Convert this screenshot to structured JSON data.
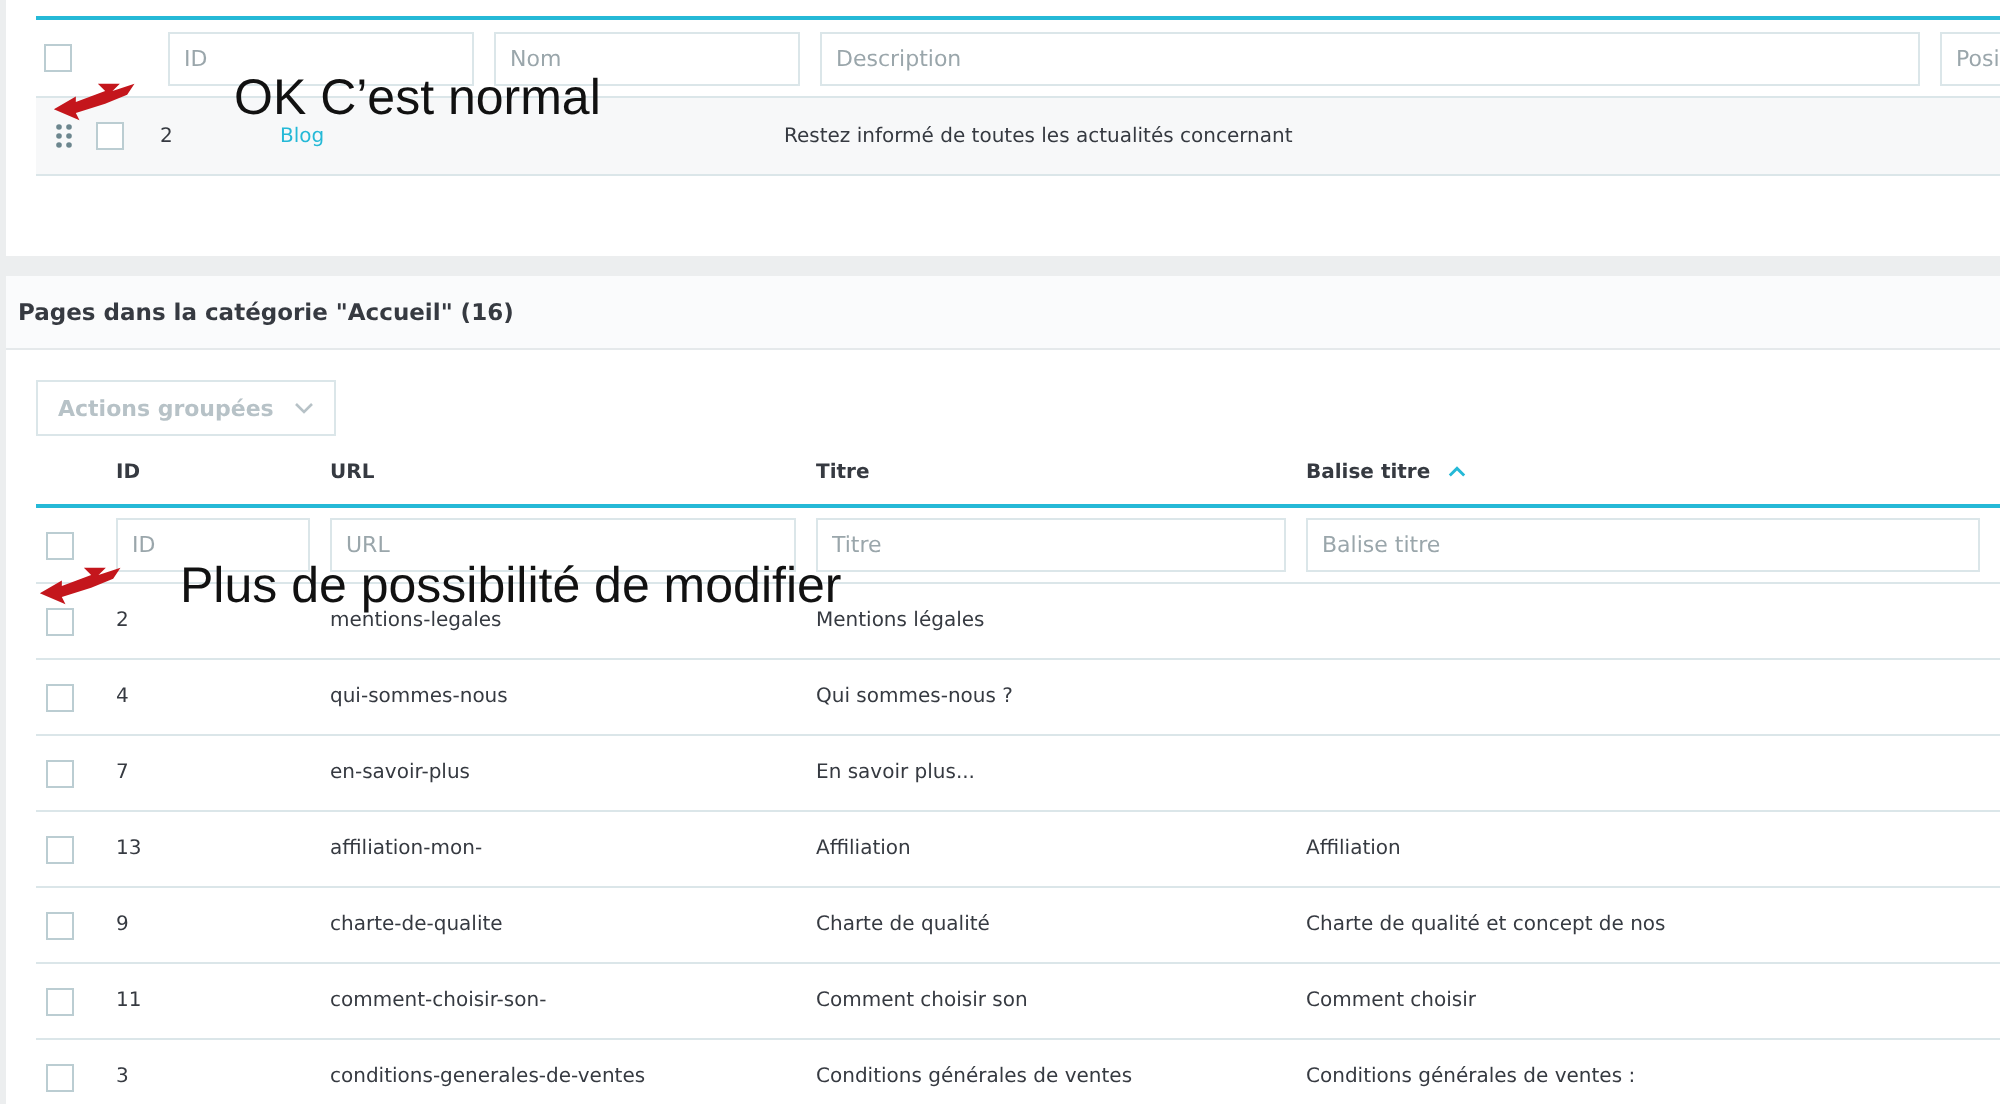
{
  "top_table": {
    "select_all_checked": false,
    "filters": [
      {
        "placeholder": "ID"
      },
      {
        "placeholder": "Nom"
      },
      {
        "placeholder": "Description"
      },
      {
        "placeholder": "Posi"
      }
    ],
    "row": {
      "id": "2",
      "name": "Blog",
      "description": "Restez informé de toutes les actualités concernant",
      "checked": false
    }
  },
  "pages_panel": {
    "title": "Pages dans la catégorie \"Accueil\" (16)",
    "bulk_button": "Actions groupées",
    "select_all_checked": false,
    "columns": [
      {
        "label": "ID",
        "sorted": false
      },
      {
        "label": "URL",
        "sorted": false
      },
      {
        "label": "Titre",
        "sorted": false
      },
      {
        "label": "Balise titre",
        "sorted": true
      }
    ],
    "filters": [
      {
        "placeholder": "ID"
      },
      {
        "placeholder": "URL"
      },
      {
        "placeholder": "Titre"
      },
      {
        "placeholder": "Balise titre"
      }
    ],
    "rows": [
      {
        "id": "2",
        "url": "mentions-legales",
        "title": "Mentions légales",
        "checked": false
      },
      {
        "id": "4",
        "url": "qui-sommes-nous",
        "title": "Qui sommes-nous ?",
        "checked": false
      },
      {
        "id": "7",
        "url": "en-savoir-plus",
        "title": "En savoir plus...",
        "checked": false
      },
      {
        "id": "13",
        "url": "affiliation-mon-",
        "title": "Affiliation",
        "meta_title": "Affiliation",
        "checked": false
      },
      {
        "id": "9",
        "url": "charte-de-qualite",
        "title": "Charte de qualité",
        "meta_title": "Charte de qualité et concept de nos",
        "checked": false
      },
      {
        "id": "11",
        "url": "comment-choisir-son-",
        "title": "Comment choisir son",
        "meta_title": "Comment choisir",
        "checked": false
      },
      {
        "id": "3",
        "url": "conditions-generales-de-ventes",
        "title": "Conditions générales de ventes",
        "meta_title": "Conditions générales de ventes :",
        "checked": false
      }
    ]
  },
  "annotations": [
    {
      "text": "OK C’est normal"
    },
    {
      "text": "Plus de possibilité de modifier"
    }
  ]
}
